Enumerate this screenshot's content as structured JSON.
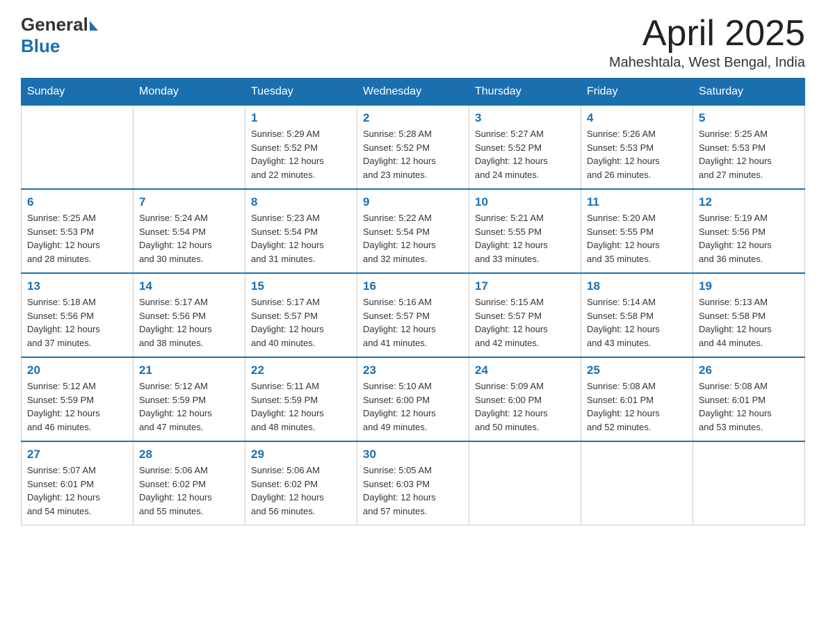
{
  "header": {
    "logo_general": "General",
    "logo_blue": "Blue",
    "month_title": "April 2025",
    "location": "Maheshtala, West Bengal, India"
  },
  "weekdays": [
    "Sunday",
    "Monday",
    "Tuesday",
    "Wednesday",
    "Thursday",
    "Friday",
    "Saturday"
  ],
  "weeks": [
    [
      {
        "day": "",
        "info": ""
      },
      {
        "day": "",
        "info": ""
      },
      {
        "day": "1",
        "info": "Sunrise: 5:29 AM\nSunset: 5:52 PM\nDaylight: 12 hours\nand 22 minutes."
      },
      {
        "day": "2",
        "info": "Sunrise: 5:28 AM\nSunset: 5:52 PM\nDaylight: 12 hours\nand 23 minutes."
      },
      {
        "day": "3",
        "info": "Sunrise: 5:27 AM\nSunset: 5:52 PM\nDaylight: 12 hours\nand 24 minutes."
      },
      {
        "day": "4",
        "info": "Sunrise: 5:26 AM\nSunset: 5:53 PM\nDaylight: 12 hours\nand 26 minutes."
      },
      {
        "day": "5",
        "info": "Sunrise: 5:25 AM\nSunset: 5:53 PM\nDaylight: 12 hours\nand 27 minutes."
      }
    ],
    [
      {
        "day": "6",
        "info": "Sunrise: 5:25 AM\nSunset: 5:53 PM\nDaylight: 12 hours\nand 28 minutes."
      },
      {
        "day": "7",
        "info": "Sunrise: 5:24 AM\nSunset: 5:54 PM\nDaylight: 12 hours\nand 30 minutes."
      },
      {
        "day": "8",
        "info": "Sunrise: 5:23 AM\nSunset: 5:54 PM\nDaylight: 12 hours\nand 31 minutes."
      },
      {
        "day": "9",
        "info": "Sunrise: 5:22 AM\nSunset: 5:54 PM\nDaylight: 12 hours\nand 32 minutes."
      },
      {
        "day": "10",
        "info": "Sunrise: 5:21 AM\nSunset: 5:55 PM\nDaylight: 12 hours\nand 33 minutes."
      },
      {
        "day": "11",
        "info": "Sunrise: 5:20 AM\nSunset: 5:55 PM\nDaylight: 12 hours\nand 35 minutes."
      },
      {
        "day": "12",
        "info": "Sunrise: 5:19 AM\nSunset: 5:56 PM\nDaylight: 12 hours\nand 36 minutes."
      }
    ],
    [
      {
        "day": "13",
        "info": "Sunrise: 5:18 AM\nSunset: 5:56 PM\nDaylight: 12 hours\nand 37 minutes."
      },
      {
        "day": "14",
        "info": "Sunrise: 5:17 AM\nSunset: 5:56 PM\nDaylight: 12 hours\nand 38 minutes."
      },
      {
        "day": "15",
        "info": "Sunrise: 5:17 AM\nSunset: 5:57 PM\nDaylight: 12 hours\nand 40 minutes."
      },
      {
        "day": "16",
        "info": "Sunrise: 5:16 AM\nSunset: 5:57 PM\nDaylight: 12 hours\nand 41 minutes."
      },
      {
        "day": "17",
        "info": "Sunrise: 5:15 AM\nSunset: 5:57 PM\nDaylight: 12 hours\nand 42 minutes."
      },
      {
        "day": "18",
        "info": "Sunrise: 5:14 AM\nSunset: 5:58 PM\nDaylight: 12 hours\nand 43 minutes."
      },
      {
        "day": "19",
        "info": "Sunrise: 5:13 AM\nSunset: 5:58 PM\nDaylight: 12 hours\nand 44 minutes."
      }
    ],
    [
      {
        "day": "20",
        "info": "Sunrise: 5:12 AM\nSunset: 5:59 PM\nDaylight: 12 hours\nand 46 minutes."
      },
      {
        "day": "21",
        "info": "Sunrise: 5:12 AM\nSunset: 5:59 PM\nDaylight: 12 hours\nand 47 minutes."
      },
      {
        "day": "22",
        "info": "Sunrise: 5:11 AM\nSunset: 5:59 PM\nDaylight: 12 hours\nand 48 minutes."
      },
      {
        "day": "23",
        "info": "Sunrise: 5:10 AM\nSunset: 6:00 PM\nDaylight: 12 hours\nand 49 minutes."
      },
      {
        "day": "24",
        "info": "Sunrise: 5:09 AM\nSunset: 6:00 PM\nDaylight: 12 hours\nand 50 minutes."
      },
      {
        "day": "25",
        "info": "Sunrise: 5:08 AM\nSunset: 6:01 PM\nDaylight: 12 hours\nand 52 minutes."
      },
      {
        "day": "26",
        "info": "Sunrise: 5:08 AM\nSunset: 6:01 PM\nDaylight: 12 hours\nand 53 minutes."
      }
    ],
    [
      {
        "day": "27",
        "info": "Sunrise: 5:07 AM\nSunset: 6:01 PM\nDaylight: 12 hours\nand 54 minutes."
      },
      {
        "day": "28",
        "info": "Sunrise: 5:06 AM\nSunset: 6:02 PM\nDaylight: 12 hours\nand 55 minutes."
      },
      {
        "day": "29",
        "info": "Sunrise: 5:06 AM\nSunset: 6:02 PM\nDaylight: 12 hours\nand 56 minutes."
      },
      {
        "day": "30",
        "info": "Sunrise: 5:05 AM\nSunset: 6:03 PM\nDaylight: 12 hours\nand 57 minutes."
      },
      {
        "day": "",
        "info": ""
      },
      {
        "day": "",
        "info": ""
      },
      {
        "day": "",
        "info": ""
      }
    ]
  ]
}
